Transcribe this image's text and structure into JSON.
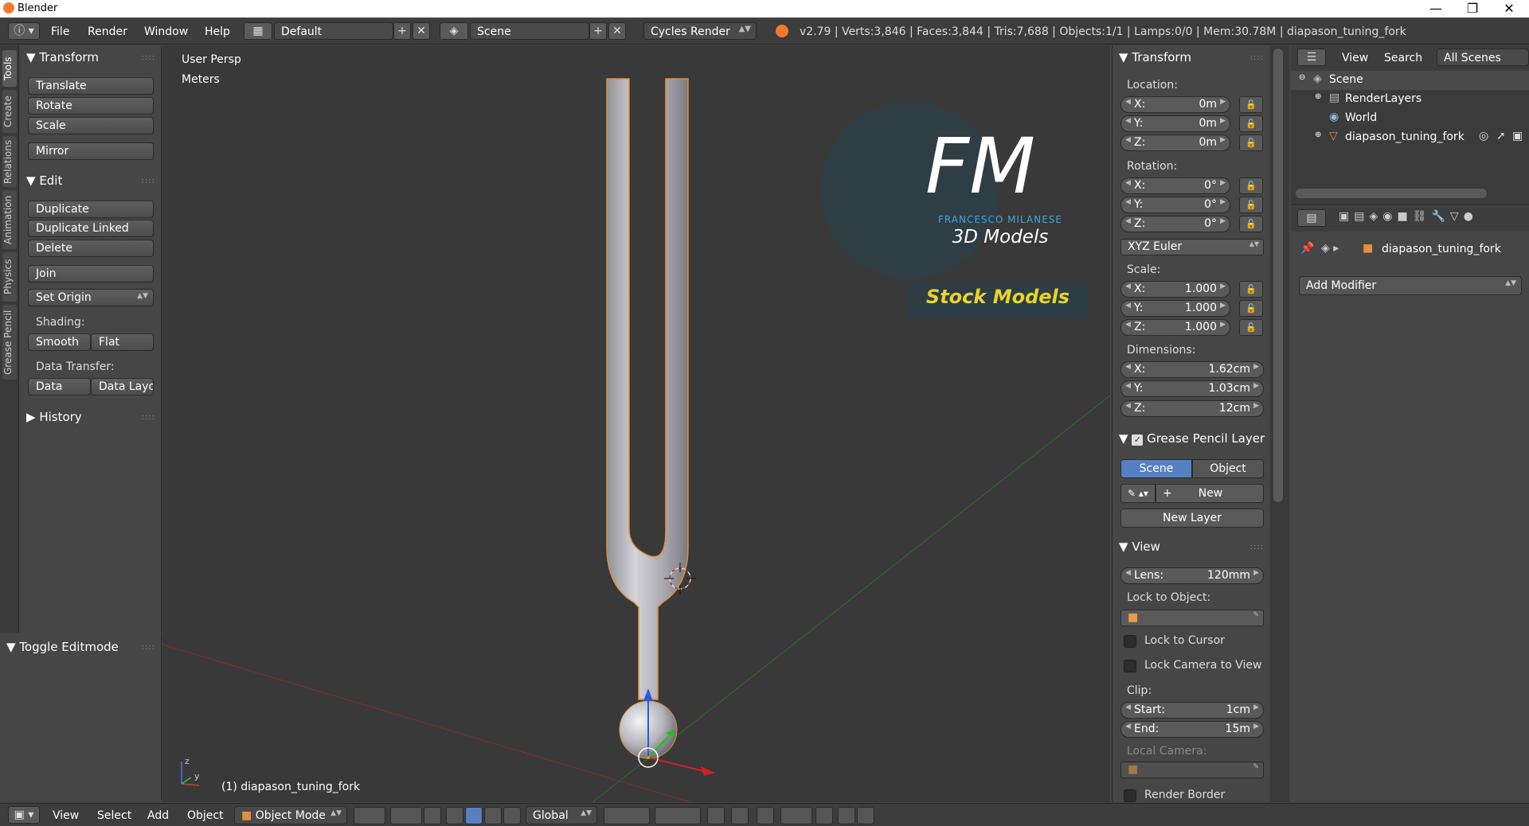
{
  "window": {
    "title": "Blender",
    "minimize": "—",
    "maximize": "❐",
    "close": "✕"
  },
  "header": {
    "menus": [
      "File",
      "Render",
      "Window",
      "Help"
    ],
    "layout": "Default",
    "scene": "Scene",
    "engine": "Cycles Render",
    "stats": "v2.79 | Verts:3,846 | Faces:3,844 | Tris:7,688 | Objects:1/1 | Lamps:0/0 | Mem:30.78M | diapason_tuning_fork"
  },
  "tabs": [
    "Tools",
    "Create",
    "Relations",
    "Animation",
    "Physics",
    "Grease Pencil"
  ],
  "toolshelf": {
    "transform_title": "Transform",
    "translate": "Translate",
    "rotate": "Rotate",
    "scale": "Scale",
    "mirror": "Mirror",
    "edit_title": "Edit",
    "duplicate": "Duplicate",
    "duplicate_linked": "Duplicate Linked",
    "delete": "Delete",
    "join": "Join",
    "set_origin": "Set Origin",
    "shading_label": "Shading:",
    "smooth": "Smooth",
    "flat": "Flat",
    "data_transfer_label": "Data Transfer:",
    "data": "Data",
    "data_layout": "Data Layo",
    "history_title": "History",
    "toggle_editmode": "Toggle Editmode"
  },
  "viewport": {
    "view_name": "User Persp",
    "units": "Meters",
    "object_label": "(1) diapason_tuning_fork",
    "watermark_initials": "FM",
    "watermark_name": "FRANCESCO MILANESE",
    "watermark_sub": "3D Models",
    "watermark_stock": "Stock Models"
  },
  "npanel": {
    "transform_title": "Transform",
    "location_label": "Location:",
    "location": [
      {
        "k": "X:",
        "v": "0m"
      },
      {
        "k": "Y:",
        "v": "0m"
      },
      {
        "k": "Z:",
        "v": "0m"
      }
    ],
    "rotation_label": "Rotation:",
    "rotation": [
      {
        "k": "X:",
        "v": "0°"
      },
      {
        "k": "Y:",
        "v": "0°"
      },
      {
        "k": "Z:",
        "v": "0°"
      }
    ],
    "rotation_mode": "XYZ Euler",
    "scale_label": "Scale:",
    "scale": [
      {
        "k": "X:",
        "v": "1.000"
      },
      {
        "k": "Y:",
        "v": "1.000"
      },
      {
        "k": "Z:",
        "v": "1.000"
      }
    ],
    "dimensions_label": "Dimensions:",
    "dimensions": [
      {
        "k": "X:",
        "v": "1.62cm"
      },
      {
        "k": "Y:",
        "v": "1.03cm"
      },
      {
        "k": "Z:",
        "v": "12cm"
      }
    ],
    "gp_title": "Grease Pencil Layer",
    "gp_scene": "Scene",
    "gp_object": "Object",
    "gp_new": "New",
    "gp_new_layer": "New Layer",
    "view_title": "View",
    "lens": {
      "k": "Lens:",
      "v": "120mm"
    },
    "lock_to_object": "Lock to Object:",
    "lock_to_cursor": "Lock to Cursor",
    "lock_camera": "Lock Camera to View",
    "clip_label": "Clip:",
    "clip_start": {
      "k": "Start:",
      "v": "1cm"
    },
    "clip_end": {
      "k": "End:",
      "v": "15m"
    },
    "local_camera": "Local Camera:",
    "render_border": "Render Border"
  },
  "outliner": {
    "view": "View",
    "search": "Search",
    "all_scenes": "All Scenes",
    "items": [
      "Scene",
      "RenderLayers",
      "World",
      "diapason_tuning_fork"
    ]
  },
  "properties": {
    "object_name": "diapason_tuning_fork",
    "add_modifier": "Add Modifier"
  },
  "bottombar": {
    "menus": [
      "View",
      "Select",
      "Add",
      "Object"
    ],
    "mode": "Object Mode",
    "orientation": "Global"
  }
}
